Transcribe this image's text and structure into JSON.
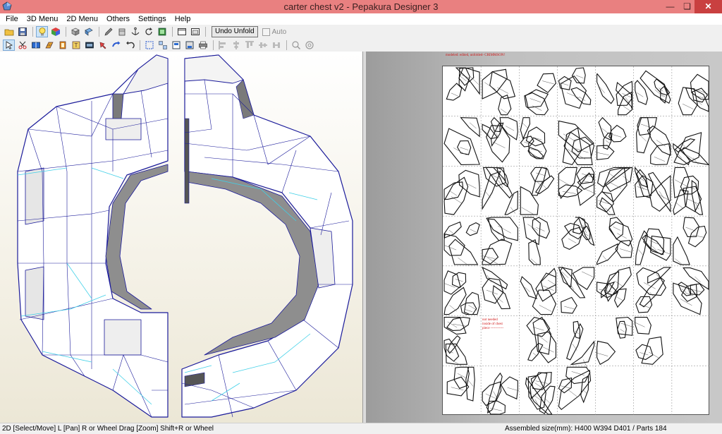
{
  "window": {
    "title": "carter chest v2 - Pepakura Designer 3",
    "controls": {
      "minimize": "—",
      "maximize": "❏",
      "close": "✕"
    }
  },
  "menu": [
    "File",
    "3D Menu",
    "2D Menu",
    "Others",
    "Settings",
    "Help"
  ],
  "toolbar": {
    "row1_icons": [
      "open-icon",
      "save-icon",
      "lightbulb-icon",
      "cube-color-icon",
      "cube-rotate-icon",
      "paste-icon",
      "edit-pencil-icon",
      "box-icon",
      "anchor-icon",
      "rotate-icon",
      "flip-icon",
      "window-single-icon",
      "window-split-icon"
    ],
    "undo_unfold_label": "Undo Unfold",
    "auto_label": "Auto",
    "row2_icons": [
      "select-icon",
      "cut-icon",
      "join-icon",
      "fold-icon",
      "flap-icon",
      "texture-icon",
      "edit-text-icon",
      "move-icon",
      "rotate-part-icon",
      "undo-icon",
      "grid-icon",
      "layout-icon",
      "page-icon",
      "print-icon",
      "align-left-icon",
      "align-center-icon",
      "align-top-icon",
      "align-middle-icon",
      "distribute-icon",
      "zoom-out-icon",
      "zoom-in-icon"
    ]
  },
  "sheet": {
    "credit": "modeled: edited, unfolded- CRIMMSON!",
    "note_lines": [
      "not needed",
      "inside of chest",
      "piece -----------"
    ]
  },
  "status": {
    "hint": "2D [Select/Move] L [Pan] R or Wheel Drag [Zoom] Shift+R or Wheel",
    "assembled": "Assembled size(mm): H400 W394 D401 / Parts 184"
  },
  "colors": {
    "titlebar": "#e98080",
    "close_button": "#c94040",
    "model_edge": "#1a1a9a",
    "model_crease": "#3fd0e8",
    "model_face": "#ffffff",
    "model_shadow": "#7a7a7a",
    "annotation": "#d01818"
  }
}
